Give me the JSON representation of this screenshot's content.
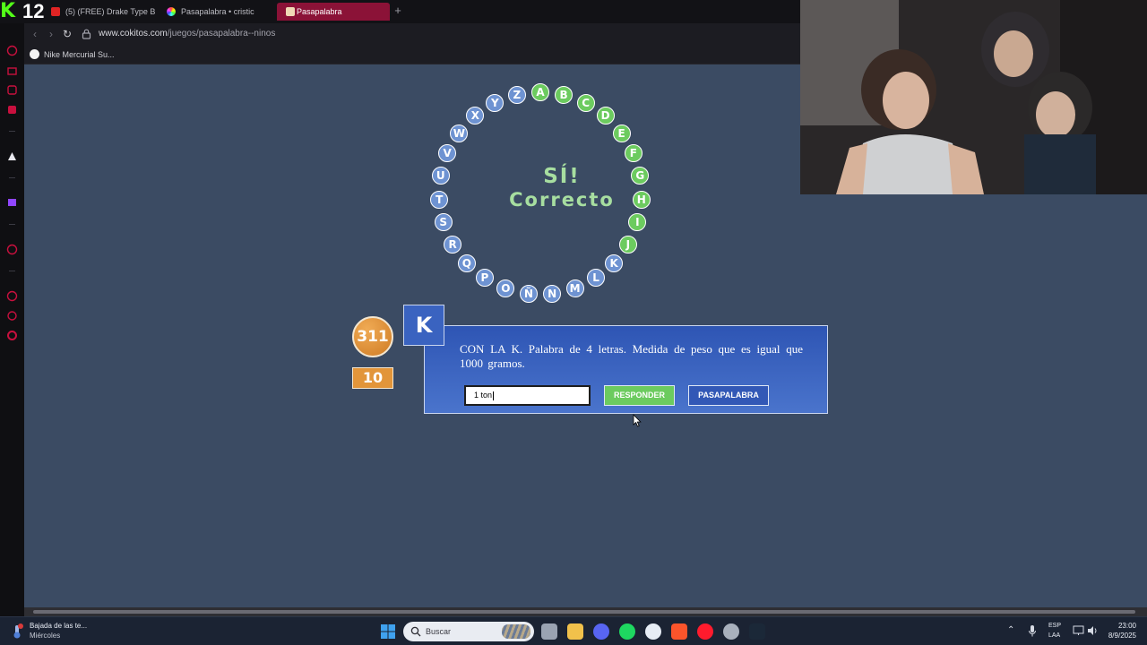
{
  "stream": {
    "number": "12",
    "logo": "K"
  },
  "browser": {
    "tabs": [
      {
        "label": "(5) (FREE) Drake Type Be..."
      },
      {
        "label": "Pasapalabra • cristic"
      },
      {
        "label": "Pasapalabra"
      }
    ],
    "new_tab": "+",
    "url_domain": "www.cokitos.com",
    "url_path": "/juegos/pasapalabra--ninos",
    "bookmark": "Nike Mercurial Su..."
  },
  "game": {
    "result_line1": "SÍ!",
    "result_line2": "Correcto",
    "rosco": [
      {
        "letter": "A",
        "state": "correct"
      },
      {
        "letter": "B",
        "state": "correct"
      },
      {
        "letter": "C",
        "state": "correct"
      },
      {
        "letter": "D",
        "state": "correct"
      },
      {
        "letter": "E",
        "state": "correct"
      },
      {
        "letter": "F",
        "state": "correct"
      },
      {
        "letter": "G",
        "state": "correct"
      },
      {
        "letter": "H",
        "state": "correct"
      },
      {
        "letter": "I",
        "state": "correct"
      },
      {
        "letter": "J",
        "state": "correct"
      },
      {
        "letter": "K",
        "state": "pending"
      },
      {
        "letter": "L",
        "state": "pending"
      },
      {
        "letter": "M",
        "state": "pending"
      },
      {
        "letter": "N",
        "state": "pending"
      },
      {
        "letter": "Ñ",
        "state": "pending"
      },
      {
        "letter": "O",
        "state": "pending"
      },
      {
        "letter": "P",
        "state": "pending"
      },
      {
        "letter": "Q",
        "state": "pending"
      },
      {
        "letter": "R",
        "state": "pending"
      },
      {
        "letter": "S",
        "state": "pending"
      },
      {
        "letter": "T",
        "state": "pending"
      },
      {
        "letter": "U",
        "state": "pending"
      },
      {
        "letter": "V",
        "state": "pending"
      },
      {
        "letter": "W",
        "state": "pending"
      },
      {
        "letter": "X",
        "state": "pending"
      },
      {
        "letter": "Y",
        "state": "pending"
      },
      {
        "letter": "Z",
        "state": "pending"
      }
    ],
    "timer": "311",
    "score": "10",
    "current_letter": "K",
    "question": "CON LA K. Palabra de 4 letras. Medida de peso que es igual que 1000 gramos.",
    "answer_value": "1 ton",
    "responder_label": "RESPONDER",
    "pasapalabra_label": "PASAPALABRA",
    "colors": {
      "correct": "#6ccb5f",
      "pending": "#6e93d2",
      "panel": "#3258b6",
      "background": "#3b4b63"
    }
  },
  "taskbar": {
    "weather_title": "Bajada de las te...",
    "weather_sub": "Miércoles",
    "search_label": "Buscar",
    "lang_1": "ESP",
    "lang_2": "LAA",
    "time": "23:00",
    "date": "8/9/2025"
  }
}
